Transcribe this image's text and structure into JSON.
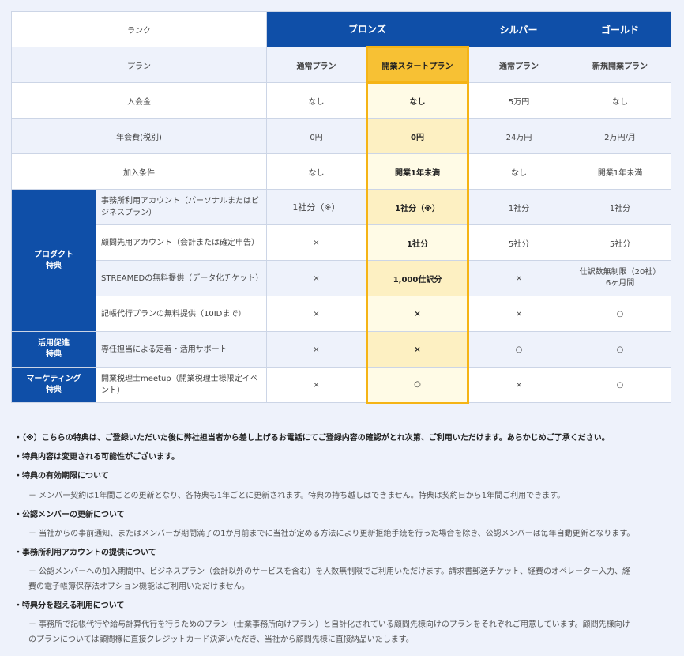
{
  "header": {
    "rank_label": "ランク",
    "plan_label": "プラン",
    "bronze": "ブロンズ",
    "silver": "シルバー",
    "gold": "ゴールド",
    "plans": [
      "通常プラン",
      "開業スタートプラン",
      "通常プラン",
      "新規開業プラン"
    ]
  },
  "rows": [
    {
      "label": "入会金",
      "cells": [
        "なし",
        "なし",
        "5万円",
        "なし"
      ]
    },
    {
      "label": "年会費(税別)",
      "cells": [
        "0円",
        "0円",
        "24万円",
        "2万円/月"
      ]
    },
    {
      "label": "加入条件",
      "cells": [
        "なし",
        "開業1年未満",
        "なし",
        "開業1年未満"
      ]
    }
  ],
  "groups": {
    "product": "プロダクト\n特典",
    "promotion": "活用促進\n特典",
    "marketing": "マーケティング\n特典"
  },
  "benefits": [
    {
      "label": "事務所利用アカウント（パーソナルまたはビジネスプラン）",
      "cells": [
        "1社分（※）",
        "1社分（※）",
        "1社分",
        "1社分"
      ]
    },
    {
      "label": "顧問先用アカウント（会計または確定申告）",
      "cells": [
        "×",
        "1社分",
        "5社分",
        "5社分"
      ]
    },
    {
      "label": "STREAMEDの無料提供（データ化チケット）",
      "cells": [
        "×",
        "1,000仕訳分",
        "×",
        "仕訳数無制限（20社）\n6ヶ月間"
      ]
    },
    {
      "label": "記帳代行プランの無料提供（10IDまで）",
      "cells": [
        "×",
        "×",
        "×",
        "○"
      ]
    },
    {
      "label": "専任担当による定着・活用サポート",
      "cells": [
        "×",
        "×",
        "○",
        "○"
      ]
    },
    {
      "label": "開業税理士meetup（開業税理士様限定イベント）",
      "cells": [
        "×",
        "○",
        "×",
        "○"
      ]
    }
  ],
  "notes": [
    "・（※）こちらの特典は、ご登録いただいた後に弊社担当者から差し上げるお電話にてご登録内容の確認がとれ次第、ご利用いただけます。あらかじめご了承ください。",
    "・特典内容は変更される可能性がございます。",
    "・特典の有効期限について",
    "－ メンバー契約は1年間ごとの更新となり、各特典も1年ごとに更新されます。特典の持ち越しはできません。特典は契約日から1年間ご利用できます。",
    "・公認メンバーの更新について",
    "－ 当社からの事前通知、またはメンバーが期間満了の1か月前までに当社が定める方法により更新拒絶手続を行った場合を除き、公認メンバーは毎年自動更新となります。",
    "・事務所利用アカウントの提供について",
    "－ 公認メンバーへの加入期間中、ビジネスプラン（会計以外のサービスを含む）を人数無制限でご利用いただけます。請求書郵送チケット、経費のオペレーター入力、経",
    "費の電子帳簿保存法オプション機能はご利用いただけません。",
    "・特典分を超える利用について",
    "－ 事務所で記帳代行や給与計算代行を行うためのプラン（士業事務所向けプラン）と自計化されている顧問先様向けのプランをそれぞれご用意しています。顧問先様向け",
    "のプランについては顧問様に直接クレジットカード決済いただき、当社から顧問先様に直接納品いたします。"
  ]
}
